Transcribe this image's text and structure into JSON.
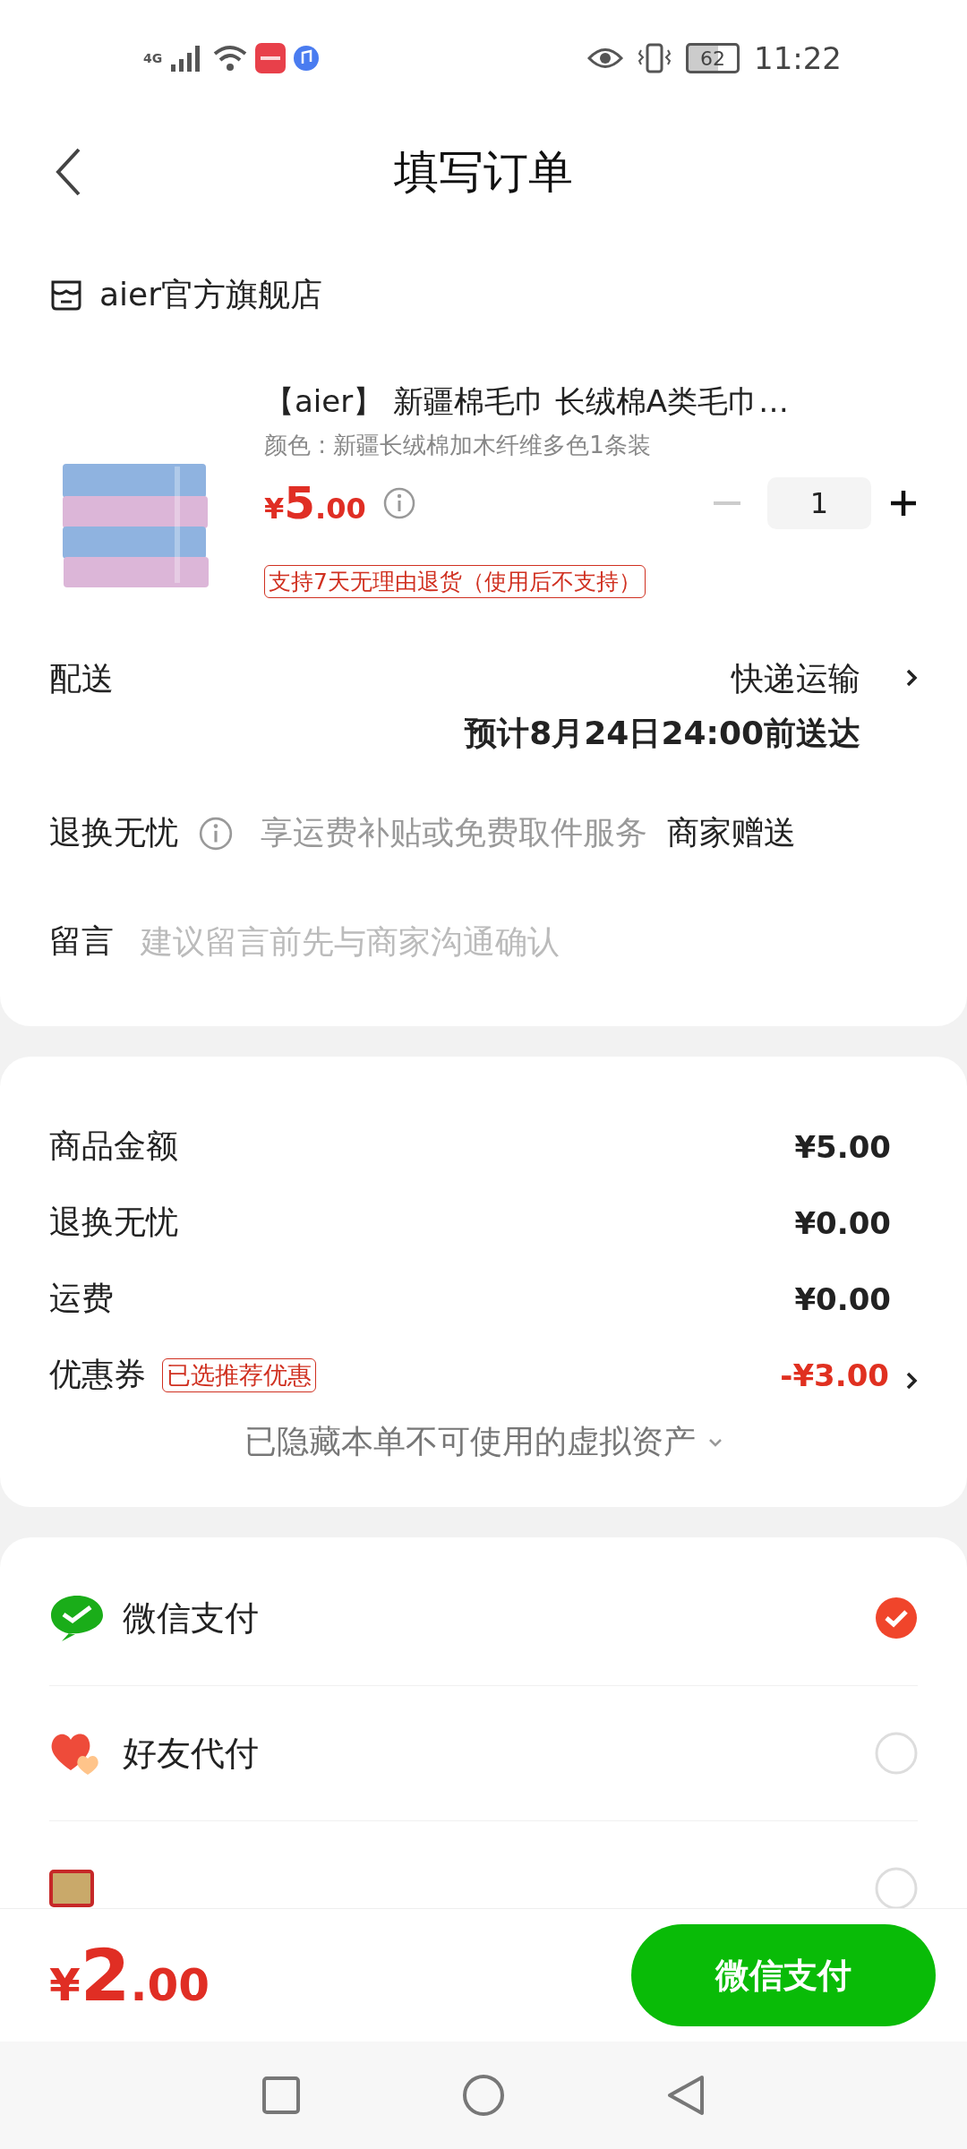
{
  "status_bar": {
    "network": "4G",
    "battery": "62",
    "time": "11:22"
  },
  "nav": {
    "title": "填写订单"
  },
  "shop": {
    "name": "aier官方旗舰店"
  },
  "product": {
    "title": "【aier】 新疆棉毛巾 长绒棉A类毛巾…",
    "variant": "颜色 : 新疆长绒棉加木纤维多色1条装",
    "currency": "¥",
    "price_int": "5",
    "price_dec": ".00",
    "quantity": "1",
    "minus_disabled": true,
    "policy": "支持7天无理由退货（使用后不支持）"
  },
  "delivery": {
    "label": "配送",
    "value": "快递运输",
    "eta": "预计8月24日24:00前送达"
  },
  "returns": {
    "label": "退换无忧",
    "description": "享运费补贴或免费取件服务",
    "value": "商家赠送"
  },
  "note": {
    "label": "留言",
    "placeholder": "建议留言前先与商家沟通确认"
  },
  "summary": {
    "rows": [
      {
        "label": "商品金额",
        "value": "¥5.00",
        "kind": "plain"
      },
      {
        "label": "退换无忧",
        "value": "¥0.00",
        "kind": "plain"
      },
      {
        "label": "运费",
        "value": "¥0.00",
        "kind": "plain"
      },
      {
        "label": "优惠券",
        "tag": "已选推荐优惠",
        "value": "-¥3.00",
        "kind": "discount"
      }
    ],
    "hidden_note": "已隐藏本单不可使用的虚拟资产"
  },
  "payment": {
    "options": [
      {
        "label": "微信支付",
        "kind": "wechat",
        "selected": true
      },
      {
        "label": "好友代付",
        "kind": "friend",
        "selected": false
      },
      {
        "kind": "card",
        "selected": false
      }
    ]
  },
  "footer": {
    "currency": "¥",
    "price_int": "2",
    "price_dec": ".00",
    "button": "微信支付"
  }
}
